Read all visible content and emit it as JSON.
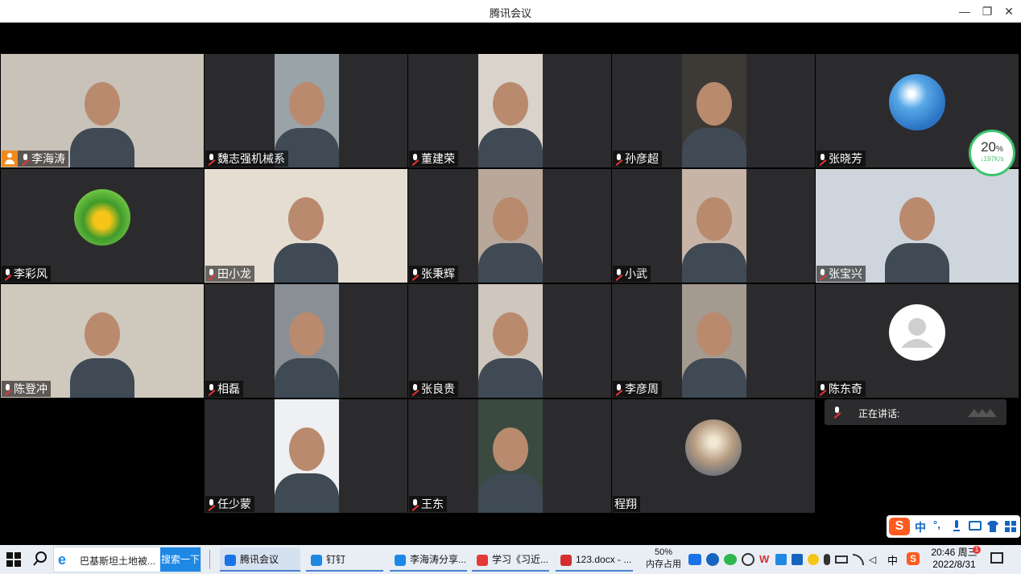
{
  "window": {
    "title": "腾讯会议",
    "minimize": "—",
    "restore": "❐",
    "close": "✕"
  },
  "participants": [
    {
      "name": "李海涛",
      "host": true
    },
    {
      "name": "魏志强机械系"
    },
    {
      "name": "董建荣"
    },
    {
      "name": "孙彦超"
    },
    {
      "name": "张晓芳",
      "avatar": "globe"
    },
    {
      "name": "李彩风",
      "avatar": "sunflower"
    },
    {
      "name": "田小龙"
    },
    {
      "name": "张秉辉"
    },
    {
      "name": "小武"
    },
    {
      "name": "张宝兴"
    },
    {
      "name": "陈登冲"
    },
    {
      "name": "相磊"
    },
    {
      "name": "张良贵"
    },
    {
      "name": "李彦周"
    },
    {
      "name": "陈东奇",
      "avatar": "default"
    },
    {
      "name": "任少蒙"
    },
    {
      "name": "王东"
    },
    {
      "name": "程翔",
      "avatar": "photo",
      "no_mic": true
    }
  ],
  "network": {
    "percent": "20",
    "unit": "%",
    "speed": "↓197K/s"
  },
  "speaking": {
    "label": "正在讲话:"
  },
  "ime": {
    "lang": "中",
    "punct": "°,"
  },
  "taskbar": {
    "search_text": "巴基斯坦土地被...",
    "search_button": "搜索一下",
    "apps": [
      {
        "label": "腾讯会议",
        "color": "#1a73e8"
      },
      {
        "label": "钉钉",
        "color": "#1e88e5"
      },
      {
        "label": "李海涛分享...",
        "color": "#1e88e5"
      },
      {
        "label": "学习《习近...",
        "color": "#e53935"
      },
      {
        "label": "123.docx - ...",
        "color": "#d32f2f"
      }
    ],
    "memory_percent": "50%",
    "memory_label": "内存占用",
    "tray_lang": "中",
    "time": "20:46 周三",
    "date": "2022/8/31",
    "notification_badge": "1"
  },
  "colors": {
    "accent": "#f08a1c",
    "network_ring": "#3ec46d",
    "taskbar": "#e9eef5"
  }
}
